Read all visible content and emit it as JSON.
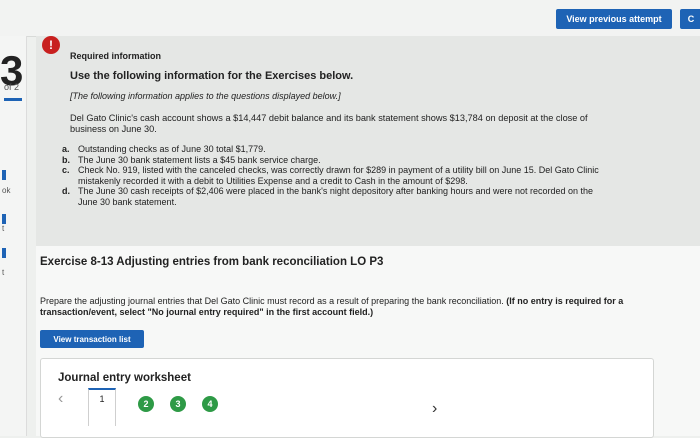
{
  "header": {
    "view_previous_attempt": "View previous attempt",
    "corner_button": "C"
  },
  "left_rail": {
    "question_number": "3",
    "of_total": "of 2",
    "ok_text": "ok",
    "mini_a": "t",
    "mini_b": "t"
  },
  "required_info": {
    "heading": "Required information",
    "use_following": "Use the following information for the Exercises below.",
    "following_applies": "[The following information applies to the questions displayed below.]",
    "paragraph": "Del Gato Clinic's cash account shows a $14,447 debit balance and its bank statement shows $13,784 on deposit at the close of business on June 30.",
    "items": [
      {
        "label": "a.",
        "text": "Outstanding checks as of June 30 total $1,779."
      },
      {
        "label": "b.",
        "text": "The June 30 bank statement lists a $45 bank service charge."
      },
      {
        "label": "c.",
        "text": "Check No. 919, listed with the canceled checks, was correctly drawn for $289 in payment of a utility bill on June 15. Del Gato Clinic mistakenly recorded it with a debit to Utilities Expense and a credit to Cash in the amount of $298."
      },
      {
        "label": "d.",
        "text": "The June 30 cash receipts of $2,406 were placed in the bank's night depository after banking hours and were not recorded on the June 30 bank statement."
      }
    ]
  },
  "exercise": {
    "title": "Exercise 8-13 Adjusting entries from bank reconciliation LO P3",
    "prepare_text": "Prepare the adjusting journal entries that Del Gato Clinic must record as a result of preparing the bank reconciliation.",
    "prepare_bold": "(If no entry is required for a transaction/event, select \"No journal entry required\" in the first account field.)",
    "view_transaction_list": "View transaction list"
  },
  "journal": {
    "title": "Journal entry worksheet",
    "prev_icon": "‹",
    "next_icon": "›",
    "pages": [
      "1",
      "2",
      "3",
      "4"
    ]
  },
  "colors": {
    "accent": "#1e63b5",
    "alert": "#c8201f",
    "done": "#2e9a46"
  }
}
